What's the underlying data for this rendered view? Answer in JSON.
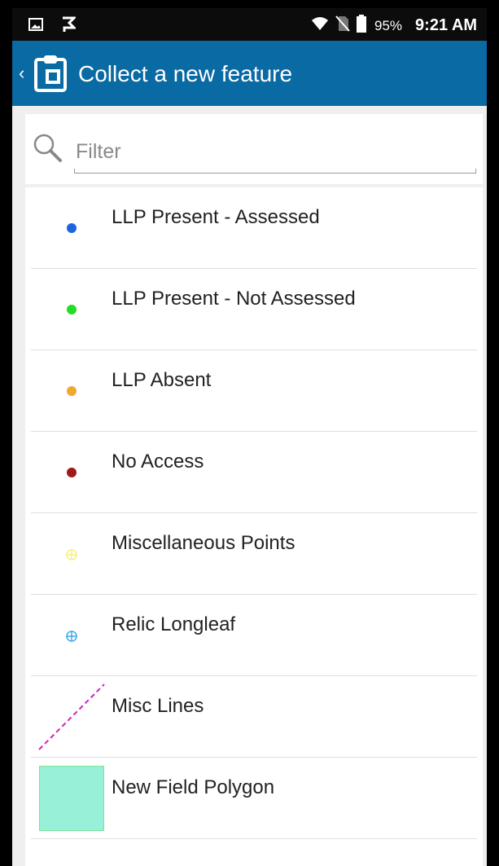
{
  "status_bar": {
    "battery_percent": "95%",
    "time": "9:21 AM"
  },
  "app_bar": {
    "title": "Collect a new feature",
    "color": "#0a6aa3"
  },
  "filter": {
    "placeholder": "Filter"
  },
  "features": [
    {
      "label": "LLP Present - Assessed",
      "symbol": "point",
      "color": "#1a66e0"
    },
    {
      "label": "LLP Present - Not Assessed",
      "symbol": "point",
      "color": "#22dd22"
    },
    {
      "label": "LLP Absent",
      "symbol": "point",
      "color": "#f0a830"
    },
    {
      "label": "No Access",
      "symbol": "point",
      "color": "#a01818"
    },
    {
      "label": "Miscellaneous Points",
      "symbol": "crosshair",
      "color": "#f5f07a"
    },
    {
      "label": "Relic Longleaf",
      "symbol": "crosshair",
      "color": "#3aa8e8"
    },
    {
      "label": "Misc Lines",
      "symbol": "dashed-line",
      "color": "#d020c0"
    },
    {
      "label": "New Field Polygon",
      "symbol": "polygon",
      "color": "#98f0d8"
    }
  ]
}
